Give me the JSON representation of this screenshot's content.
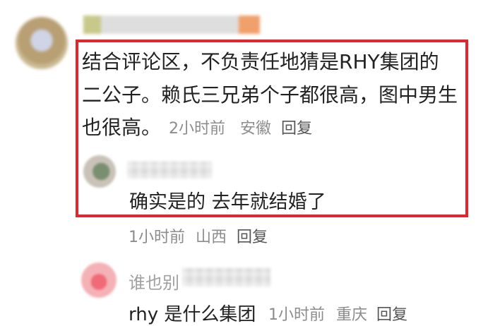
{
  "comment1": {
    "lines": [
      "结合评论区，不负责任地猜是RHY集团的",
      "二公子。赖氏三兄弟个子都很高，图中男生",
      "也很高。"
    ],
    "meta": {
      "time": "2小时前",
      "location": "安徽",
      "reply_label": "回复"
    }
  },
  "reply1": {
    "text": "确实是的 去年就结婚了",
    "meta": {
      "time": "1小时前",
      "location": "山西",
      "reply_label": "回复"
    }
  },
  "reply2": {
    "username_partial": "谁也别",
    "text": "rhy 是什么集团",
    "meta": {
      "time": "1小时前",
      "location": "重庆",
      "reply_label": "回复"
    }
  },
  "colors": {
    "highlight_border": "#e3262d",
    "meta_text": "#8c8c8c",
    "body_text": "#222222"
  }
}
